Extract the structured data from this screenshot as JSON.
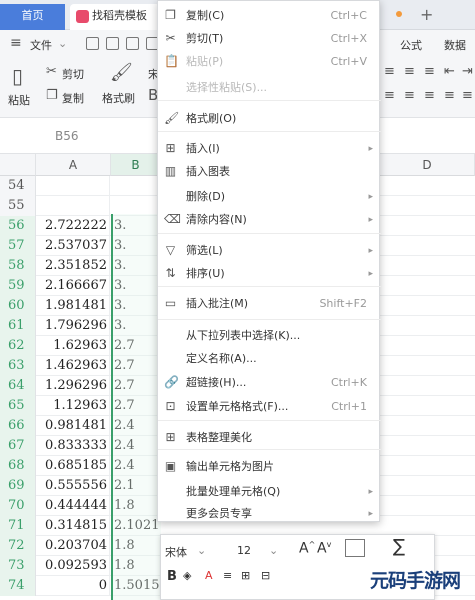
{
  "tabs": {
    "home": "首页",
    "template": "找稻壳模板"
  },
  "menubar": {
    "file": "文件",
    "formula": "公式",
    "data": "数据"
  },
  "ribbon": {
    "cut": "剪切",
    "copy": "复制",
    "paste": "粘贴",
    "format_painter": "格式刷",
    "font_partial": "宋"
  },
  "formula_bar": {
    "name_box": "B56"
  },
  "grid": {
    "columns": [
      "A",
      "B",
      "D"
    ],
    "rows": [
      {
        "n": "54",
        "a": "",
        "b": ""
      },
      {
        "n": "55",
        "a": "",
        "b": ""
      },
      {
        "n": "56",
        "a": "2.722222",
        "b": "3."
      },
      {
        "n": "57",
        "a": "2.537037",
        "b": "3."
      },
      {
        "n": "58",
        "a": "2.351852",
        "b": "3."
      },
      {
        "n": "59",
        "a": "2.166667",
        "b": "3."
      },
      {
        "n": "60",
        "a": "1.981481",
        "b": "3."
      },
      {
        "n": "61",
        "a": "1.796296",
        "b": "3."
      },
      {
        "n": "62",
        "a": "1.62963",
        "b": "2.7"
      },
      {
        "n": "63",
        "a": "1.462963",
        "b": "2.7"
      },
      {
        "n": "64",
        "a": "1.296296",
        "b": "2.7"
      },
      {
        "n": "65",
        "a": "1.12963",
        "b": "2.7"
      },
      {
        "n": "66",
        "a": "0.981481",
        "b": "2.4"
      },
      {
        "n": "67",
        "a": "0.833333",
        "b": "2.4"
      },
      {
        "n": "68",
        "a": "0.685185",
        "b": "2.4"
      },
      {
        "n": "69",
        "a": "0.555556",
        "b": "2.1"
      },
      {
        "n": "70",
        "a": "0.444444",
        "b": "1.8"
      },
      {
        "n": "71",
        "a": "0.314815",
        "b": "2.1021"
      },
      {
        "n": "72",
        "a": "0.203704",
        "b": "1.8"
      },
      {
        "n": "73",
        "a": "0.092593",
        "b": "1.8"
      },
      {
        "n": "74",
        "a": "0",
        "b": "1.5015"
      }
    ]
  },
  "context_menu": {
    "items": [
      {
        "label": "复制(C)",
        "shortcut": "Ctrl+C",
        "icon": "copy-icon",
        "glyph": "❐"
      },
      {
        "label": "剪切(T)",
        "shortcut": "Ctrl+X",
        "icon": "scissors-icon",
        "glyph": "✂"
      },
      {
        "label": "粘贴(P)",
        "shortcut": "Ctrl+V",
        "icon": "paste-icon",
        "glyph": "📋"
      },
      {
        "label": "选择性粘贴(S)...",
        "shortcut": "",
        "icon": "paste-special-icon",
        "glyph": ""
      },
      {
        "label": "格式刷(O)",
        "shortcut": "",
        "icon": "format-painter-icon",
        "glyph": "🖌"
      },
      {
        "label": "插入(I)",
        "shortcut": "",
        "icon": "insert-icon",
        "glyph": "⊞"
      },
      {
        "label": "插入图表",
        "shortcut": "",
        "icon": "chart-icon",
        "glyph": "▥"
      },
      {
        "label": "删除(D)",
        "shortcut": "",
        "icon": "delete-icon",
        "glyph": ""
      },
      {
        "label": "清除内容(N)",
        "shortcut": "",
        "icon": "eraser-icon",
        "glyph": "⌫"
      },
      {
        "label": "筛选(L)",
        "shortcut": "",
        "icon": "filter-icon",
        "glyph": "▽"
      },
      {
        "label": "排序(U)",
        "shortcut": "",
        "icon": "sort-icon",
        "glyph": "⇅"
      },
      {
        "label": "插入批注(M)",
        "shortcut": "Shift+F2",
        "icon": "comment-icon",
        "glyph": "▭"
      },
      {
        "label": "从下拉列表中选择(K)...",
        "shortcut": "",
        "icon": "dropdown-list-icon",
        "glyph": ""
      },
      {
        "label": "定义名称(A)...",
        "shortcut": "",
        "icon": "define-name-icon",
        "glyph": ""
      },
      {
        "label": "超链接(H)...",
        "shortcut": "Ctrl+K",
        "icon": "link-icon",
        "glyph": "🔗"
      },
      {
        "label": "设置单元格格式(F)...",
        "shortcut": "Ctrl+1",
        "icon": "cell-format-icon",
        "glyph": "⊡"
      },
      {
        "label": "表格整理美化",
        "shortcut": "",
        "icon": "table-beautify-icon",
        "glyph": "⊞"
      },
      {
        "label": "输出单元格为图片",
        "shortcut": "",
        "icon": "image-export-icon",
        "glyph": "▣"
      },
      {
        "label": "批量处理单元格(Q)",
        "shortcut": "",
        "icon": "batch-icon",
        "glyph": ""
      },
      {
        "label": "更多会员专享",
        "shortcut": "",
        "icon": "member-icon",
        "glyph": ""
      }
    ]
  },
  "mini_toolbar": {
    "font": "宋体",
    "size": "12",
    "bold": "B"
  },
  "watermark": {
    "text": "元码手游网"
  }
}
